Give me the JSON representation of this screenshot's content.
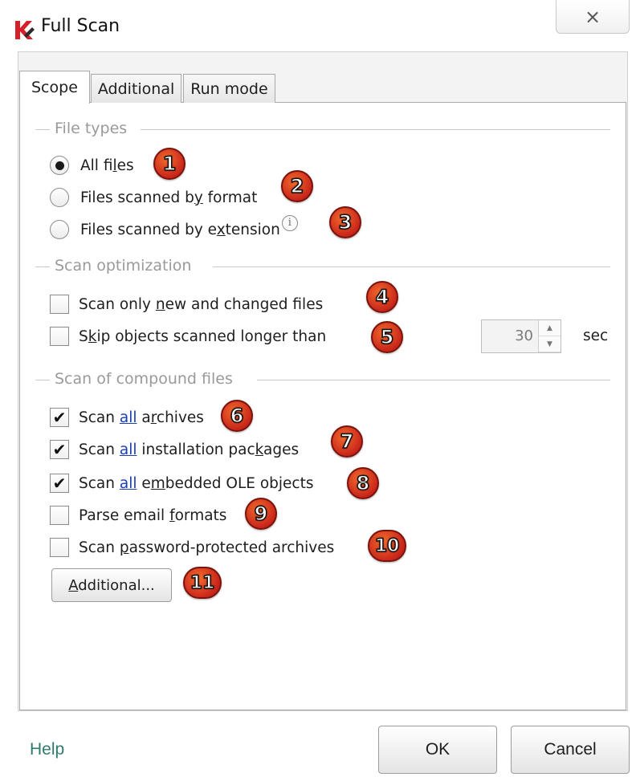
{
  "window": {
    "title": "Full Scan",
    "close_glyph": "×",
    "logo_icon": "kaspersky-logo-icon"
  },
  "tabs": [
    {
      "label": "Scope",
      "active": true
    },
    {
      "label": "Additional",
      "active": false
    },
    {
      "label": "Run mode",
      "active": false
    }
  ],
  "file_types": {
    "title": "File types",
    "options": [
      {
        "label_pre": "All fi",
        "label_u": "l",
        "label_post": "es",
        "selected": true,
        "marker": "1"
      },
      {
        "label_pre": "Files scanned b",
        "label_u": "y",
        "label_post": " format",
        "selected": false,
        "marker": "2"
      },
      {
        "label_pre": "Files scanned by e",
        "label_u": "x",
        "label_post": "tension",
        "selected": false,
        "marker": "3",
        "info_glyph": "i"
      }
    ]
  },
  "scan_optimization": {
    "title": "Scan optimization",
    "options": [
      {
        "label_pre": "Scan only ",
        "label_u": "n",
        "label_post": "ew and changed files",
        "checked": false,
        "marker": "4"
      },
      {
        "label_pre": "S",
        "label_u": "k",
        "label_post": "ip objects scanned longer than",
        "checked": false,
        "marker": "5"
      }
    ],
    "timeout_value": "30",
    "timeout_unit": "sec"
  },
  "compound_files": {
    "title": "Scan of compound files",
    "options": [
      {
        "pre": "Scan ",
        "link": "all",
        "mid_pre": " a",
        "mid_u": "r",
        "post": "chives",
        "checked": true,
        "marker": "6"
      },
      {
        "pre": "Scan ",
        "link": "all",
        "mid_pre": " installation pac",
        "mid_u": "k",
        "post": "ages",
        "checked": true,
        "marker": "7"
      },
      {
        "pre": "Scan ",
        "link": "all",
        "mid_pre": " e",
        "mid_u": "m",
        "post": "bedded OLE objects",
        "checked": true,
        "marker": "8"
      },
      {
        "pre": "Parse email ",
        "link": "",
        "mid_pre": "",
        "mid_u": "f",
        "post": "ormats",
        "checked": false,
        "marker": "9"
      },
      {
        "pre": "Scan ",
        "link": "",
        "mid_pre": "",
        "mid_u": "p",
        "post": "assword-protected archives",
        "checked": false,
        "marker": "10"
      }
    ],
    "additional_button_u": "A",
    "additional_button_rest": "dditional...",
    "additional_marker": "11"
  },
  "footer": {
    "help": "Help",
    "ok": "OK",
    "cancel": "Cancel"
  },
  "colors": {
    "accent_link": "#1a3db8",
    "help_text": "#2e7b6e",
    "marker_fill": "#e2431f"
  }
}
